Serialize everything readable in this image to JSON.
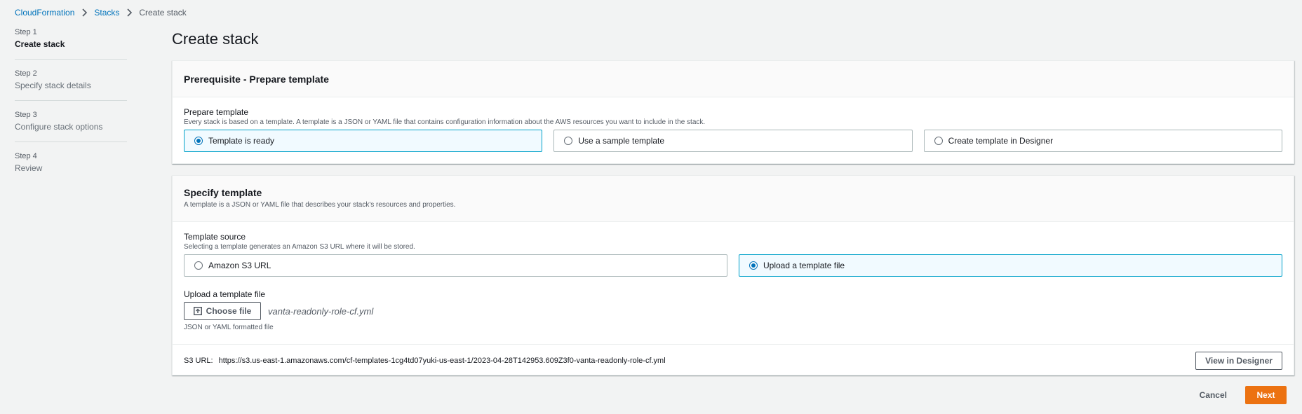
{
  "breadcrumb": {
    "items": [
      "CloudFormation",
      "Stacks"
    ],
    "current": "Create stack"
  },
  "steps": [
    {
      "num": "Step 1",
      "title": "Create stack"
    },
    {
      "num": "Step 2",
      "title": "Specify stack details"
    },
    {
      "num": "Step 3",
      "title": "Configure stack options"
    },
    {
      "num": "Step 4",
      "title": "Review"
    }
  ],
  "page": {
    "title": "Create stack"
  },
  "prereq": {
    "header": "Prerequisite - Prepare template",
    "label": "Prepare template",
    "desc": "Every stack is based on a template. A template is a JSON or YAML file that contains configuration information about the AWS resources you want to include in the stack.",
    "options": [
      "Template is ready",
      "Use a sample template",
      "Create template in Designer"
    ],
    "selected": "Template is ready"
  },
  "specify": {
    "header": "Specify template",
    "header_desc": "A template is a JSON or YAML file that describes your stack's resources and properties.",
    "source_label": "Template source",
    "source_desc": "Selecting a template generates an Amazon S3 URL where it will be stored.",
    "options": [
      "Amazon S3 URL",
      "Upload a template file"
    ],
    "selected": "Upload a template file",
    "upload_label": "Upload a template file",
    "choose_file_label": "Choose file",
    "file_name": "vanta-readonly-role-cf.yml",
    "file_hint": "JSON or YAML formatted file",
    "s3_label": "S3 URL:",
    "s3_url": "https://s3.us-east-1.amazonaws.com/cf-templates-1cg4td07yuki-us-east-1/2023-04-28T142953.609Z3f0-vanta-readonly-role-cf.yml",
    "view_designer_label": "View in Designer"
  },
  "footer": {
    "cancel_label": "Cancel",
    "next_label": "Next"
  },
  "colors": {
    "accent": "#0073bb",
    "primary_button": "#ec7211",
    "selected_border": "#00a1c9"
  }
}
